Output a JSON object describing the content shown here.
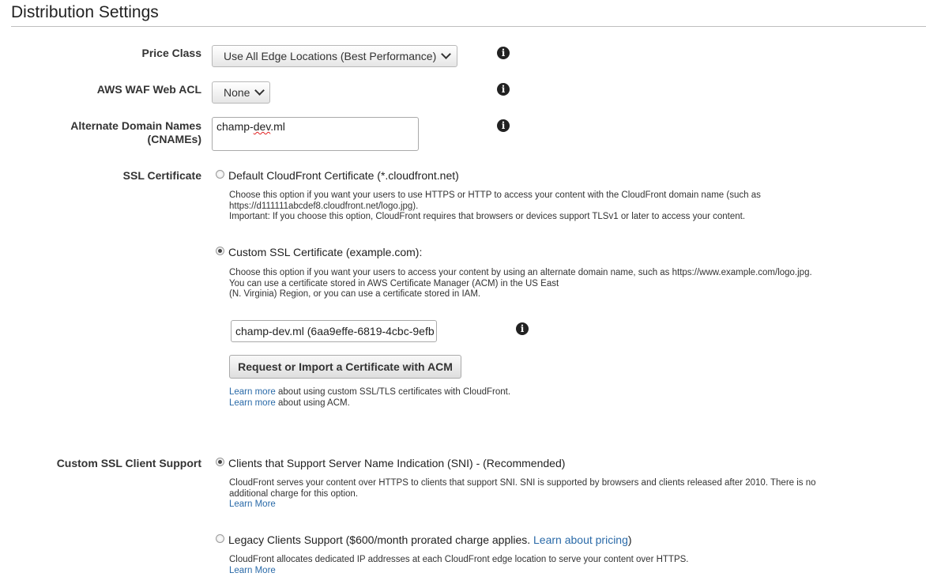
{
  "section_title": "Distribution Settings",
  "price_class": {
    "label": "Price Class",
    "value": "Use All Edge Locations (Best Performance)"
  },
  "waf": {
    "label": "AWS WAF Web ACL",
    "value": "None"
  },
  "cnames": {
    "label_line1": "Alternate Domain Names",
    "label_line2": "(CNAMEs)",
    "value_prefix": "champ-",
    "value_misspelled": "dev",
    "value_suffix": ".ml"
  },
  "ssl": {
    "label": "SSL Certificate",
    "default_option": "Default CloudFront Certificate (*.cloudfront.net)",
    "default_desc_line1": "Choose this option if you want your users to use HTTPS or HTTP to access your content with the CloudFront domain name (such as",
    "default_desc_line2": "https://d111111abcdef8.cloudfront.net/logo.jpg).",
    "default_desc_line3": "Important: If you choose this option, CloudFront requires that browsers or devices support TLSv1 or later to access your content.",
    "custom_option": "Custom SSL Certificate (example.com):",
    "custom_desc_line1": "Choose this option if you want your users to access your content by using an alternate domain name, such as https://www.example.com/logo.jpg.",
    "custom_desc_line2": "You can use a certificate stored in AWS Certificate Manager (ACM) in the US East",
    "custom_desc_line3": "(N. Virginia) Region, or you can use a certificate stored in IAM.",
    "certificate_value": "champ-dev.ml (6aa9effe-6819-4cbc-9efb",
    "acm_button": "Request or Import a Certificate with ACM",
    "learn_more_1": "Learn more",
    "learn_more_1_text": " about using custom SSL/TLS certificates with CloudFront.",
    "learn_more_2": "Learn more",
    "learn_more_2_text": " about using ACM."
  },
  "client_support": {
    "label": "Custom SSL Client Support",
    "sni_option": "Clients that Support Server Name Indication (SNI) - (Recommended)",
    "sni_desc_line1": "CloudFront serves your content over HTTPS to clients that support SNI. SNI is supported by browsers and clients released after 2010. There is no",
    "sni_desc_line2": "additional charge for this option.",
    "sni_learn_more": "Learn More",
    "legacy_option_prefix": "Legacy Clients Support ($600/month prorated charge applies. ",
    "legacy_pricing_link": "Learn about pricing",
    "legacy_option_suffix": ")",
    "legacy_desc": "CloudFront allocates dedicated IP addresses at each CloudFront edge location to serve your content over HTTPS.",
    "legacy_learn_more": "Learn More"
  },
  "icons": {
    "info": "i"
  }
}
